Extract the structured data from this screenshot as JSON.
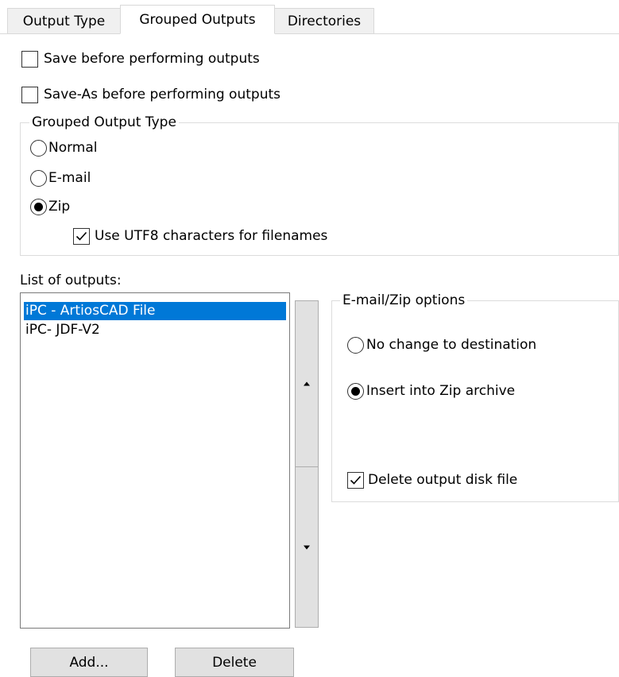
{
  "tabs": [
    {
      "label": "Output Type"
    },
    {
      "label": "Grouped Outputs"
    },
    {
      "label": "Directories"
    }
  ],
  "options": {
    "save_before": {
      "label": "Save before performing outputs",
      "checked": false
    },
    "save_as_before": {
      "label": "Save-As before performing outputs",
      "checked": false
    }
  },
  "grouped_output_type": {
    "title": "Grouped Output Type",
    "options": [
      {
        "label": "Normal",
        "selected": false
      },
      {
        "label": "E-mail",
        "selected": false
      },
      {
        "label": "Zip",
        "selected": true
      }
    ],
    "utf8": {
      "label": "Use UTF8 characters for filenames",
      "checked": true
    }
  },
  "outputs": {
    "label": "List of outputs:",
    "items": [
      "iPC - ArtiosCAD File",
      "iPC- JDF-V2"
    ],
    "selected_index": 0
  },
  "email_zip": {
    "title": "E-mail/Zip options",
    "options": [
      {
        "label": "No change to destination",
        "selected": false
      },
      {
        "label": "Insert into Zip archive",
        "selected": true
      }
    ],
    "delete_output": {
      "label": "Delete output disk file",
      "checked": true
    }
  },
  "buttons": {
    "add": "Add...",
    "delete": "Delete"
  },
  "icons": {
    "up": "up-arrow-icon",
    "down": "down-arrow-icon"
  }
}
